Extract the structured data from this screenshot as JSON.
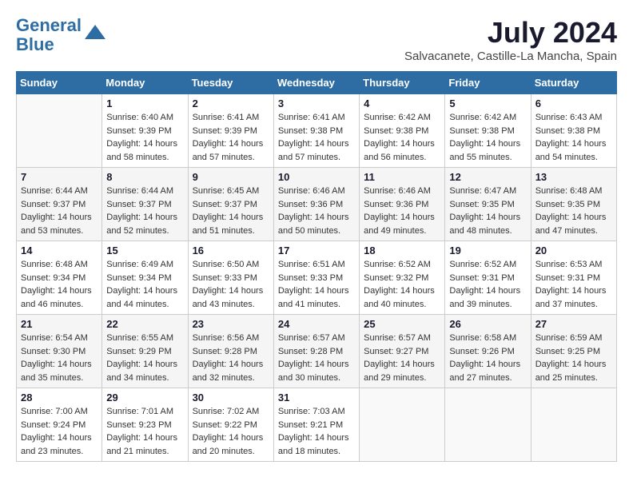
{
  "header": {
    "logo_line1": "General",
    "logo_line2": "Blue",
    "month_year": "July 2024",
    "location": "Salvacanete, Castille-La Mancha, Spain"
  },
  "weekdays": [
    "Sunday",
    "Monday",
    "Tuesday",
    "Wednesday",
    "Thursday",
    "Friday",
    "Saturday"
  ],
  "weeks": [
    [
      {
        "day": "",
        "detail": ""
      },
      {
        "day": "1",
        "detail": "Sunrise: 6:40 AM\nSunset: 9:39 PM\nDaylight: 14 hours\nand 58 minutes."
      },
      {
        "day": "2",
        "detail": "Sunrise: 6:41 AM\nSunset: 9:39 PM\nDaylight: 14 hours\nand 57 minutes."
      },
      {
        "day": "3",
        "detail": "Sunrise: 6:41 AM\nSunset: 9:38 PM\nDaylight: 14 hours\nand 57 minutes."
      },
      {
        "day": "4",
        "detail": "Sunrise: 6:42 AM\nSunset: 9:38 PM\nDaylight: 14 hours\nand 56 minutes."
      },
      {
        "day": "5",
        "detail": "Sunrise: 6:42 AM\nSunset: 9:38 PM\nDaylight: 14 hours\nand 55 minutes."
      },
      {
        "day": "6",
        "detail": "Sunrise: 6:43 AM\nSunset: 9:38 PM\nDaylight: 14 hours\nand 54 minutes."
      }
    ],
    [
      {
        "day": "7",
        "detail": "Sunrise: 6:44 AM\nSunset: 9:37 PM\nDaylight: 14 hours\nand 53 minutes."
      },
      {
        "day": "8",
        "detail": "Sunrise: 6:44 AM\nSunset: 9:37 PM\nDaylight: 14 hours\nand 52 minutes."
      },
      {
        "day": "9",
        "detail": "Sunrise: 6:45 AM\nSunset: 9:37 PM\nDaylight: 14 hours\nand 51 minutes."
      },
      {
        "day": "10",
        "detail": "Sunrise: 6:46 AM\nSunset: 9:36 PM\nDaylight: 14 hours\nand 50 minutes."
      },
      {
        "day": "11",
        "detail": "Sunrise: 6:46 AM\nSunset: 9:36 PM\nDaylight: 14 hours\nand 49 minutes."
      },
      {
        "day": "12",
        "detail": "Sunrise: 6:47 AM\nSunset: 9:35 PM\nDaylight: 14 hours\nand 48 minutes."
      },
      {
        "day": "13",
        "detail": "Sunrise: 6:48 AM\nSunset: 9:35 PM\nDaylight: 14 hours\nand 47 minutes."
      }
    ],
    [
      {
        "day": "14",
        "detail": "Sunrise: 6:48 AM\nSunset: 9:34 PM\nDaylight: 14 hours\nand 46 minutes."
      },
      {
        "day": "15",
        "detail": "Sunrise: 6:49 AM\nSunset: 9:34 PM\nDaylight: 14 hours\nand 44 minutes."
      },
      {
        "day": "16",
        "detail": "Sunrise: 6:50 AM\nSunset: 9:33 PM\nDaylight: 14 hours\nand 43 minutes."
      },
      {
        "day": "17",
        "detail": "Sunrise: 6:51 AM\nSunset: 9:33 PM\nDaylight: 14 hours\nand 41 minutes."
      },
      {
        "day": "18",
        "detail": "Sunrise: 6:52 AM\nSunset: 9:32 PM\nDaylight: 14 hours\nand 40 minutes."
      },
      {
        "day": "19",
        "detail": "Sunrise: 6:52 AM\nSunset: 9:31 PM\nDaylight: 14 hours\nand 39 minutes."
      },
      {
        "day": "20",
        "detail": "Sunrise: 6:53 AM\nSunset: 9:31 PM\nDaylight: 14 hours\nand 37 minutes."
      }
    ],
    [
      {
        "day": "21",
        "detail": "Sunrise: 6:54 AM\nSunset: 9:30 PM\nDaylight: 14 hours\nand 35 minutes."
      },
      {
        "day": "22",
        "detail": "Sunrise: 6:55 AM\nSunset: 9:29 PM\nDaylight: 14 hours\nand 34 minutes."
      },
      {
        "day": "23",
        "detail": "Sunrise: 6:56 AM\nSunset: 9:28 PM\nDaylight: 14 hours\nand 32 minutes."
      },
      {
        "day": "24",
        "detail": "Sunrise: 6:57 AM\nSunset: 9:28 PM\nDaylight: 14 hours\nand 30 minutes."
      },
      {
        "day": "25",
        "detail": "Sunrise: 6:57 AM\nSunset: 9:27 PM\nDaylight: 14 hours\nand 29 minutes."
      },
      {
        "day": "26",
        "detail": "Sunrise: 6:58 AM\nSunset: 9:26 PM\nDaylight: 14 hours\nand 27 minutes."
      },
      {
        "day": "27",
        "detail": "Sunrise: 6:59 AM\nSunset: 9:25 PM\nDaylight: 14 hours\nand 25 minutes."
      }
    ],
    [
      {
        "day": "28",
        "detail": "Sunrise: 7:00 AM\nSunset: 9:24 PM\nDaylight: 14 hours\nand 23 minutes."
      },
      {
        "day": "29",
        "detail": "Sunrise: 7:01 AM\nSunset: 9:23 PM\nDaylight: 14 hours\nand 21 minutes."
      },
      {
        "day": "30",
        "detail": "Sunrise: 7:02 AM\nSunset: 9:22 PM\nDaylight: 14 hours\nand 20 minutes."
      },
      {
        "day": "31",
        "detail": "Sunrise: 7:03 AM\nSunset: 9:21 PM\nDaylight: 14 hours\nand 18 minutes."
      },
      {
        "day": "",
        "detail": ""
      },
      {
        "day": "",
        "detail": ""
      },
      {
        "day": "",
        "detail": ""
      }
    ]
  ]
}
